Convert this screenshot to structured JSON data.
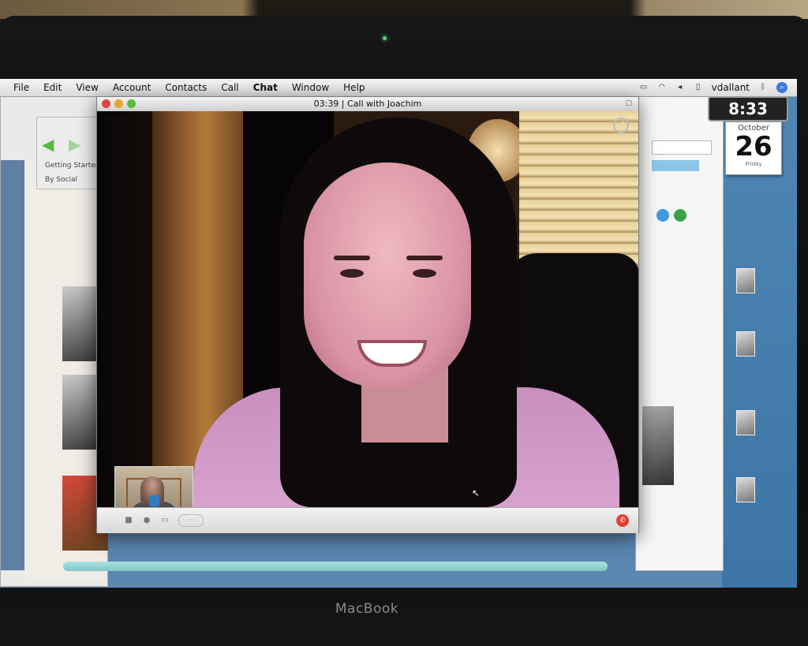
{
  "menubar": {
    "items": [
      "File",
      "Edit",
      "View",
      "Account",
      "Contacts",
      "Call",
      "Chat",
      "Window",
      "Help"
    ],
    "user": "vdallant"
  },
  "call_window": {
    "title": "03:39 | Call with Joachim"
  },
  "widgets": {
    "clock": "8:33",
    "calendar_month": "October",
    "calendar_day": "26",
    "calendar_weekday": "Friday"
  },
  "background": {
    "tab_getting_started": "Getting Started",
    "tab_second": "By Social"
  },
  "device": {
    "brand": "MacBook"
  },
  "colors": {
    "hangup": "#e2402f",
    "menubar": "#e8e8e8"
  }
}
